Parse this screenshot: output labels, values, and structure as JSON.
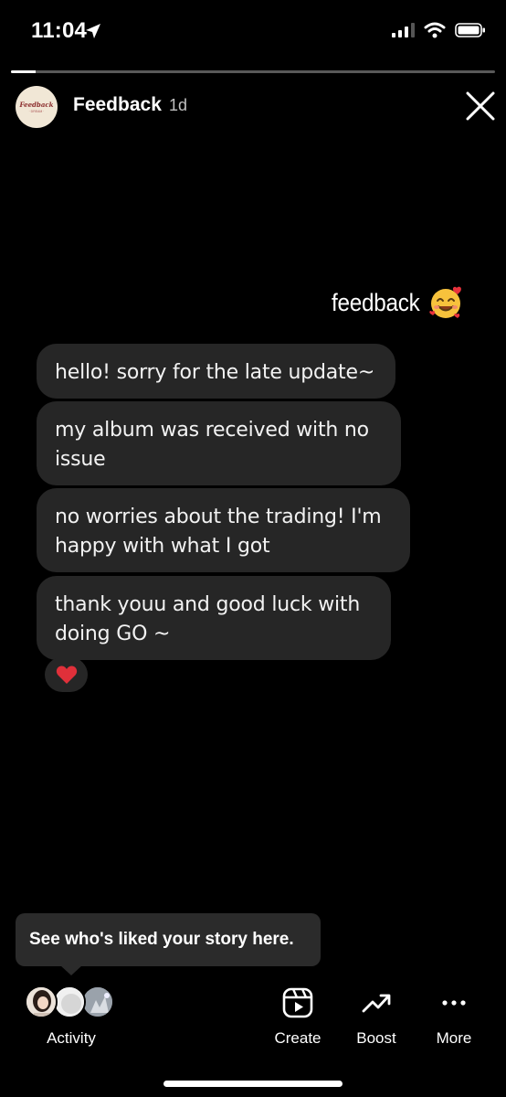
{
  "status_bar": {
    "time": "11:04",
    "icons": [
      "location-arrow-icon",
      "cellular-signal-icon",
      "wifi-icon",
      "battery-icon"
    ]
  },
  "story": {
    "progress": 0.05,
    "account_name": "Feedback",
    "age": "1d",
    "avatar_logo_text": "Feedback",
    "avatar_logo_sub": "· DREAM ·",
    "sticker_text": "feedback",
    "sticker_emoji": "smiling-face-with-hearts"
  },
  "messages": [
    "hello! sorry for the late update~",
    "my album was received with no issue",
    "no worries about the trading! I'm happy with what I got",
    "thank youu and good luck with doing GO ~"
  ],
  "reaction": "heart",
  "tooltip": {
    "text": "See who's liked your story here."
  },
  "bottom_bar": {
    "activity_label": "Activity",
    "create_label": "Create",
    "boost_label": "Boost",
    "more_label": "More"
  },
  "colors": {
    "background": "#000000",
    "bubble": "#262626",
    "tooltip": "#2b2b2b",
    "heart": "#e0303a"
  }
}
